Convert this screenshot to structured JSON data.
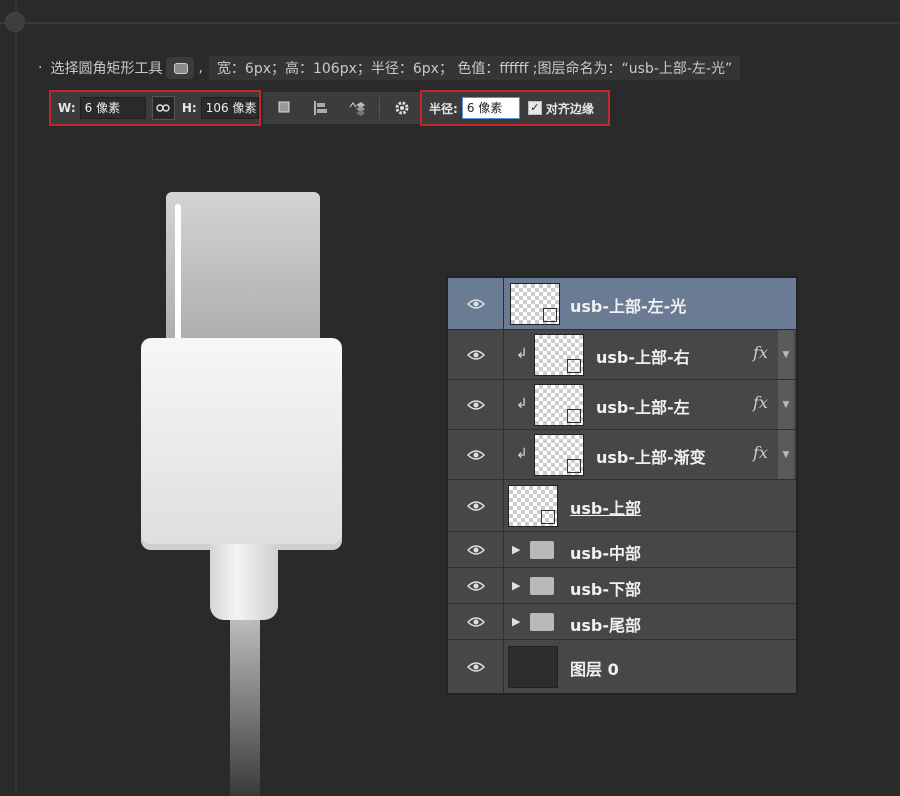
{
  "instruction": {
    "bullet": "·",
    "prefix": "选择圆角矩形工具",
    "comma": ",",
    "spec": "宽：6px；高：106px；半径：6px； 色值：ffffff ;图层命名为：“usb-上部-左-光”"
  },
  "options": {
    "w_label": "W:",
    "w_value": "6 像素",
    "h_label": "H:",
    "h_value": "106 像素",
    "radius_label": "半径:",
    "radius_value": "6 像素",
    "align_edges_label": "对齐边缘",
    "align_edges_checked": true,
    "highlight_color": "#c1272d"
  },
  "layers": [
    {
      "name": "usb-上部-左-光",
      "type": "shape",
      "selected": true,
      "clipped": false,
      "fx": ""
    },
    {
      "name": "usb-上部-右",
      "type": "shape",
      "selected": false,
      "clipped": true,
      "fx": "fx"
    },
    {
      "name": "usb-上部-左",
      "type": "shape",
      "selected": false,
      "clipped": true,
      "fx": "fx"
    },
    {
      "name": "usb-上部-渐变",
      "type": "shape",
      "selected": false,
      "clipped": true,
      "fx": "fx"
    },
    {
      "name": "usb-上部",
      "type": "shape",
      "selected": false,
      "clipped": false,
      "fx": ""
    },
    {
      "name": "usb-中部",
      "type": "group",
      "selected": false,
      "clipped": false,
      "fx": ""
    },
    {
      "name": "usb-下部",
      "type": "group",
      "selected": false,
      "clipped": false,
      "fx": ""
    },
    {
      "name": "usb-尾部",
      "type": "group",
      "selected": false,
      "clipped": false,
      "fx": ""
    },
    {
      "name": "图层 0",
      "type": "pixel",
      "selected": false,
      "clipped": false,
      "fx": ""
    }
  ],
  "icons": {
    "eye": "eye-icon",
    "link": "link-icon",
    "clip": "clip-arrow-icon",
    "expand": "expand-triangle-icon",
    "folder": "folder-icon",
    "gear": "gear-icon",
    "path_ops": "path-operations-icon",
    "path_align": "path-alignment-icon",
    "path_arrange": "path-arrangement-icon"
  },
  "colors": {
    "canvas": "#2a2a2a",
    "panel": "#474747",
    "selected_row": "#6a7b93"
  }
}
